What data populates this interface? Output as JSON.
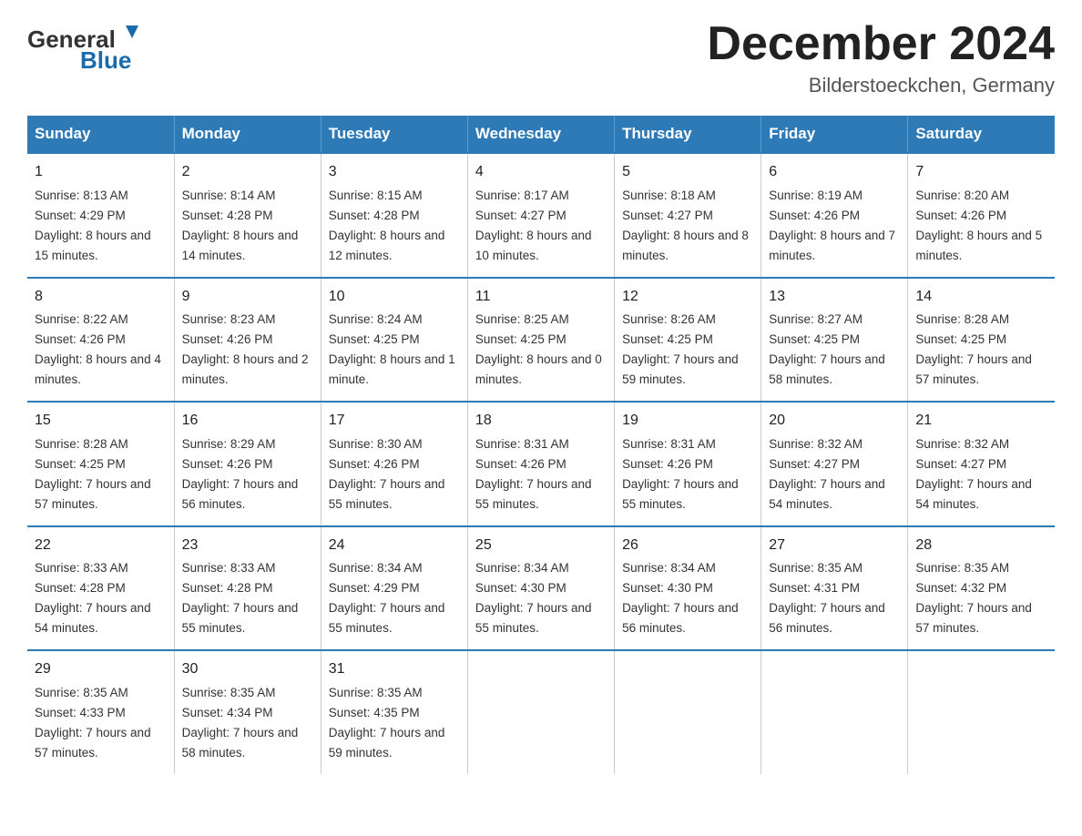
{
  "header": {
    "logo_general": "General",
    "logo_blue": "Blue",
    "title": "December 2024",
    "subtitle": "Bilderstoeckchen, Germany"
  },
  "days_of_week": [
    "Sunday",
    "Monday",
    "Tuesday",
    "Wednesday",
    "Thursday",
    "Friday",
    "Saturday"
  ],
  "weeks": [
    [
      {
        "day": "1",
        "sunrise": "8:13 AM",
        "sunset": "4:29 PM",
        "daylight": "8 hours and 15 minutes."
      },
      {
        "day": "2",
        "sunrise": "8:14 AM",
        "sunset": "4:28 PM",
        "daylight": "8 hours and 14 minutes."
      },
      {
        "day": "3",
        "sunrise": "8:15 AM",
        "sunset": "4:28 PM",
        "daylight": "8 hours and 12 minutes."
      },
      {
        "day": "4",
        "sunrise": "8:17 AM",
        "sunset": "4:27 PM",
        "daylight": "8 hours and 10 minutes."
      },
      {
        "day": "5",
        "sunrise": "8:18 AM",
        "sunset": "4:27 PM",
        "daylight": "8 hours and 8 minutes."
      },
      {
        "day": "6",
        "sunrise": "8:19 AM",
        "sunset": "4:26 PM",
        "daylight": "8 hours and 7 minutes."
      },
      {
        "day": "7",
        "sunrise": "8:20 AM",
        "sunset": "4:26 PM",
        "daylight": "8 hours and 5 minutes."
      }
    ],
    [
      {
        "day": "8",
        "sunrise": "8:22 AM",
        "sunset": "4:26 PM",
        "daylight": "8 hours and 4 minutes."
      },
      {
        "day": "9",
        "sunrise": "8:23 AM",
        "sunset": "4:26 PM",
        "daylight": "8 hours and 2 minutes."
      },
      {
        "day": "10",
        "sunrise": "8:24 AM",
        "sunset": "4:25 PM",
        "daylight": "8 hours and 1 minute."
      },
      {
        "day": "11",
        "sunrise": "8:25 AM",
        "sunset": "4:25 PM",
        "daylight": "8 hours and 0 minutes."
      },
      {
        "day": "12",
        "sunrise": "8:26 AM",
        "sunset": "4:25 PM",
        "daylight": "7 hours and 59 minutes."
      },
      {
        "day": "13",
        "sunrise": "8:27 AM",
        "sunset": "4:25 PM",
        "daylight": "7 hours and 58 minutes."
      },
      {
        "day": "14",
        "sunrise": "8:28 AM",
        "sunset": "4:25 PM",
        "daylight": "7 hours and 57 minutes."
      }
    ],
    [
      {
        "day": "15",
        "sunrise": "8:28 AM",
        "sunset": "4:25 PM",
        "daylight": "7 hours and 57 minutes."
      },
      {
        "day": "16",
        "sunrise": "8:29 AM",
        "sunset": "4:26 PM",
        "daylight": "7 hours and 56 minutes."
      },
      {
        "day": "17",
        "sunrise": "8:30 AM",
        "sunset": "4:26 PM",
        "daylight": "7 hours and 55 minutes."
      },
      {
        "day": "18",
        "sunrise": "8:31 AM",
        "sunset": "4:26 PM",
        "daylight": "7 hours and 55 minutes."
      },
      {
        "day": "19",
        "sunrise": "8:31 AM",
        "sunset": "4:26 PM",
        "daylight": "7 hours and 55 minutes."
      },
      {
        "day": "20",
        "sunrise": "8:32 AM",
        "sunset": "4:27 PM",
        "daylight": "7 hours and 54 minutes."
      },
      {
        "day": "21",
        "sunrise": "8:32 AM",
        "sunset": "4:27 PM",
        "daylight": "7 hours and 54 minutes."
      }
    ],
    [
      {
        "day": "22",
        "sunrise": "8:33 AM",
        "sunset": "4:28 PM",
        "daylight": "7 hours and 54 minutes."
      },
      {
        "day": "23",
        "sunrise": "8:33 AM",
        "sunset": "4:28 PM",
        "daylight": "7 hours and 55 minutes."
      },
      {
        "day": "24",
        "sunrise": "8:34 AM",
        "sunset": "4:29 PM",
        "daylight": "7 hours and 55 minutes."
      },
      {
        "day": "25",
        "sunrise": "8:34 AM",
        "sunset": "4:30 PM",
        "daylight": "7 hours and 55 minutes."
      },
      {
        "day": "26",
        "sunrise": "8:34 AM",
        "sunset": "4:30 PM",
        "daylight": "7 hours and 56 minutes."
      },
      {
        "day": "27",
        "sunrise": "8:35 AM",
        "sunset": "4:31 PM",
        "daylight": "7 hours and 56 minutes."
      },
      {
        "day": "28",
        "sunrise": "8:35 AM",
        "sunset": "4:32 PM",
        "daylight": "7 hours and 57 minutes."
      }
    ],
    [
      {
        "day": "29",
        "sunrise": "8:35 AM",
        "sunset": "4:33 PM",
        "daylight": "7 hours and 57 minutes."
      },
      {
        "day": "30",
        "sunrise": "8:35 AM",
        "sunset": "4:34 PM",
        "daylight": "7 hours and 58 minutes."
      },
      {
        "day": "31",
        "sunrise": "8:35 AM",
        "sunset": "4:35 PM",
        "daylight": "7 hours and 59 minutes."
      },
      null,
      null,
      null,
      null
    ]
  ],
  "labels": {
    "sunrise": "Sunrise:",
    "sunset": "Sunset:",
    "daylight": "Daylight:"
  }
}
